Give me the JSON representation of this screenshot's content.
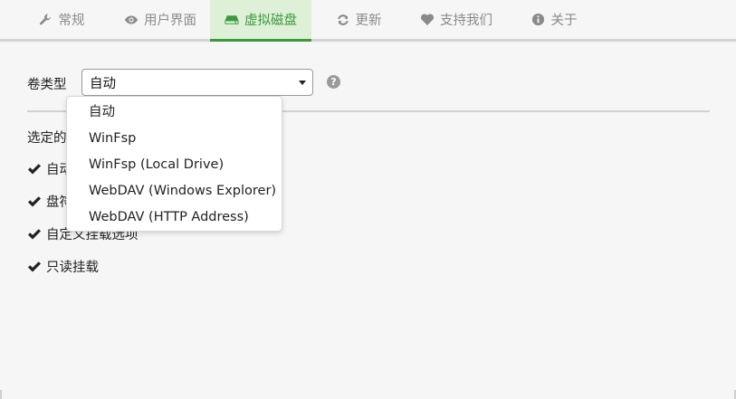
{
  "tabs": [
    {
      "label": "常规",
      "icon": "wrench-icon"
    },
    {
      "label": "用户界面",
      "icon": "eye-icon"
    },
    {
      "label": "虚拟磁盘",
      "icon": "drive-icon",
      "active": true
    },
    {
      "label": "更新",
      "icon": "refresh-icon"
    },
    {
      "label": "支持我们",
      "icon": "heart-icon"
    },
    {
      "label": "关于",
      "icon": "info-icon"
    }
  ],
  "volume_type": {
    "label": "卷类型",
    "selected": "自动",
    "help": "?",
    "options": [
      "自动",
      "WinFsp",
      "WinFsp (Local Drive)",
      "WebDAV (Windows Explorer)",
      "WebDAV (HTTP Address)"
    ]
  },
  "section": {
    "label_visible": "选定的"
  },
  "checks": [
    {
      "label": "自动",
      "obscured": true
    },
    {
      "label": "盘符",
      "obscured": true
    },
    {
      "label": "自定义挂载选项",
      "obscured": true
    },
    {
      "label": "只读挂载"
    }
  ],
  "colors": {
    "accent": "#3a9a3a",
    "active_tab_bg": "#dff0d8",
    "background": "#f6f6f6"
  }
}
